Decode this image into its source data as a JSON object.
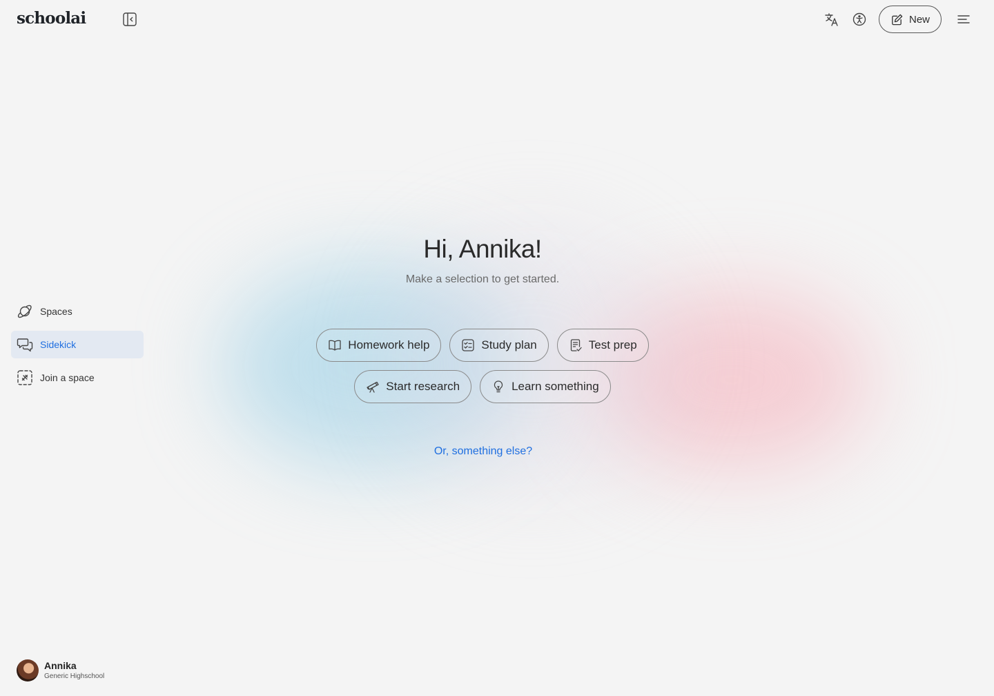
{
  "header": {
    "logo_text": "schoolai",
    "new_button_label": "New"
  },
  "main": {
    "greeting": "Hi, Annika!",
    "subtitle": "Make a selection to get started.",
    "options": [
      {
        "label": "Homework help",
        "icon": "book-open-icon"
      },
      {
        "label": "Study plan",
        "icon": "checklist-icon"
      },
      {
        "label": "Test prep",
        "icon": "document-check-icon"
      },
      {
        "label": "Start research",
        "icon": "telescope-icon"
      },
      {
        "label": "Learn something",
        "icon": "lightbulb-icon"
      }
    ],
    "other_link": "Or, something else?"
  },
  "sidebar": {
    "items": [
      {
        "label": "Spaces",
        "icon": "planet-icon",
        "active": false
      },
      {
        "label": "Sidekick",
        "icon": "chat-bubbles-icon",
        "active": true
      },
      {
        "label": "Join a space",
        "icon": "join-space-icon",
        "active": false
      }
    ]
  },
  "user": {
    "name": "Annika",
    "school": "Generic Highschool"
  },
  "colors": {
    "accent": "#1f6fe0",
    "background": "#f4f4f4",
    "active_item_bg": "#e3e9f2"
  }
}
